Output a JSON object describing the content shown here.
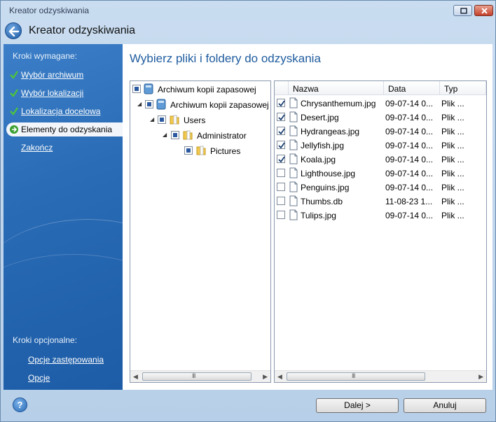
{
  "window": {
    "title": "Kreator odzyskiwania"
  },
  "header": {
    "title": "Kreator odzyskiwania"
  },
  "sidebar": {
    "required_heading": "Kroki wymagane:",
    "items": [
      {
        "label": "Wybór archiwum",
        "done": true,
        "active": false
      },
      {
        "label": "Wybór lokalizacji",
        "done": true,
        "active": false
      },
      {
        "label": "Lokalizacja docelowa",
        "done": true,
        "active": false
      },
      {
        "label": "Elementy do odzyskania",
        "done": false,
        "active": true
      },
      {
        "label": "Zakończ",
        "done": false,
        "active": false
      }
    ],
    "optional_heading": "Kroki opcjonalne:",
    "optional_items": [
      {
        "label": "Opcje zastępowania"
      },
      {
        "label": "Opcje"
      }
    ]
  },
  "main": {
    "title": "Wybierz pliki i foldery do odzyskania"
  },
  "tree": {
    "nodes": [
      {
        "label": "Archiwum kopii zapasowej",
        "icon": "drive-icon"
      },
      {
        "label": "Archiwum kopii zapasowej",
        "icon": "drive-icon"
      },
      {
        "label": "Users",
        "icon": "folder-icon"
      },
      {
        "label": "Administrator",
        "icon": "folder-icon"
      },
      {
        "label": "Pictures",
        "icon": "folder-icon"
      }
    ]
  },
  "files": {
    "columns": [
      "Nazwa",
      "Data",
      "Typ"
    ],
    "rows": [
      {
        "name": "Chrysanthemum.jpg",
        "date": "09-07-14 0...",
        "type": "Plik ...",
        "checked": true
      },
      {
        "name": "Desert.jpg",
        "date": "09-07-14 0...",
        "type": "Plik ...",
        "checked": true
      },
      {
        "name": "Hydrangeas.jpg",
        "date": "09-07-14 0...",
        "type": "Plik ...",
        "checked": true
      },
      {
        "name": "Jellyfish.jpg",
        "date": "09-07-14 0...",
        "type": "Plik ...",
        "checked": true
      },
      {
        "name": "Koala.jpg",
        "date": "09-07-14 0...",
        "type": "Plik ...",
        "checked": true
      },
      {
        "name": "Lighthouse.jpg",
        "date": "09-07-14 0...",
        "type": "Plik ...",
        "checked": false
      },
      {
        "name": "Penguins.jpg",
        "date": "09-07-14 0...",
        "type": "Plik ...",
        "checked": false
      },
      {
        "name": "Thumbs.db",
        "date": "11-08-23 1...",
        "type": "Plik ...",
        "checked": false
      },
      {
        "name": "Tulips.jpg",
        "date": "09-07-14 0...",
        "type": "Plik ...",
        "checked": false
      }
    ]
  },
  "scrollbar": {
    "grip": "III"
  },
  "footer": {
    "help": "?",
    "next_label": "Dalej >",
    "cancel_label": "Anuluj"
  },
  "colors": {
    "sidebar": "#2a6cb6",
    "title_accent": "#1f5c9f",
    "check_green": "#3aa02f"
  }
}
